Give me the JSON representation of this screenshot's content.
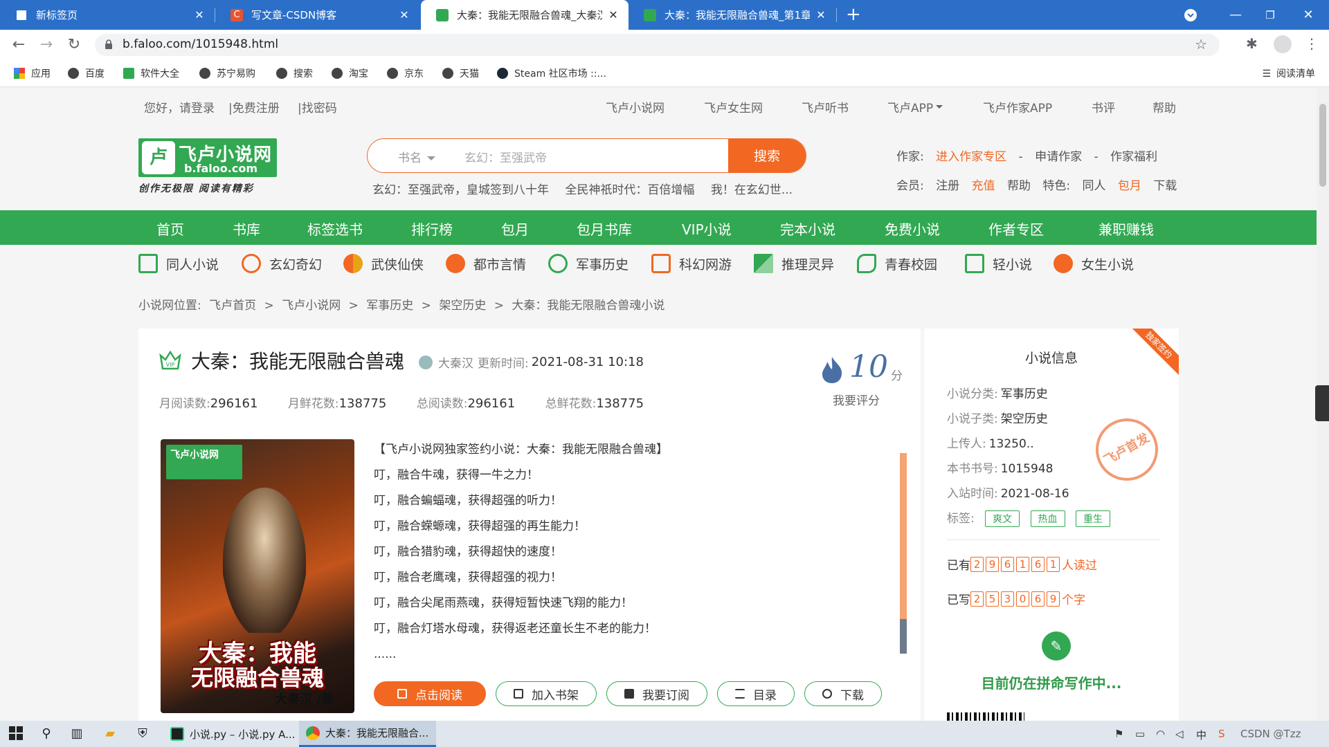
{
  "browser": {
    "tabs": [
      {
        "title": "新标签页",
        "active": false
      },
      {
        "title": "写文章-CSDN博客",
        "active": false
      },
      {
        "title": "大秦：我能无限融合兽魂_大秦汉",
        "active": true
      },
      {
        "title": "大秦：我能无限融合兽魂_第1章",
        "active": false
      }
    ],
    "url": "b.faloo.com/1015948.html",
    "bookmarks": [
      "应用",
      "百度",
      "软件大全",
      "苏宁易购",
      "搜索",
      "淘宝",
      "京东",
      "天猫",
      "Steam 社区市场 ::..."
    ],
    "reading_list": "阅读清单"
  },
  "topbar": {
    "greeting": "您好，请登录",
    "register": "|免费注册",
    "findpwd": "|找密码",
    "links": [
      "飞卢小说网",
      "飞卢女生网",
      "飞卢听书",
      "飞卢APP",
      "飞卢作家APP",
      "书评",
      "帮助"
    ]
  },
  "header": {
    "logo_name": "飞卢小说网",
    "logo_domain": "b.faloo.com",
    "logo_slogan": "创作无极限 阅读有精彩",
    "search_type": "书名",
    "search_placeholder": "玄幻：至强武帝",
    "search_button": "搜索",
    "hot": [
      "玄幻：至强武帝，皇城签到八十年",
      "全民神祇时代：百倍增幅",
      "我！在玄幻世..."
    ],
    "author_label": "作家:",
    "author_links": [
      "进入作家专区",
      "-",
      "申请作家",
      "-",
      "作家福利"
    ],
    "member_label": "会员:",
    "member_links": [
      "注册",
      "充值",
      "帮助",
      "特色:",
      "同人",
      "包月",
      "下载"
    ]
  },
  "mainnav": [
    "首页",
    "书库",
    "标签选书",
    "排行榜",
    "包月",
    "包月书库",
    "VIP小说",
    "完本小说",
    "免费小说",
    "作者专区",
    "兼职赚钱"
  ],
  "categories": [
    {
      "label": "同人小说",
      "color": "#32a852"
    },
    {
      "label": "玄幻奇幻",
      "color": "#f26722"
    },
    {
      "label": "武侠仙侠",
      "color": "#e8a317"
    },
    {
      "label": "都市言情",
      "color": "#f26722"
    },
    {
      "label": "军事历史",
      "color": "#32a852"
    },
    {
      "label": "科幻网游",
      "color": "#f26722"
    },
    {
      "label": "推理灵异",
      "color": "#32a852"
    },
    {
      "label": "青春校园",
      "color": "#32a852"
    },
    {
      "label": "轻小说",
      "color": "#32a852"
    },
    {
      "label": "女生小说",
      "color": "#f26722"
    }
  ],
  "breadcrumb": [
    "小说网位置:",
    "飞卢首页",
    ">",
    "飞卢小说网",
    ">",
    "军事历史",
    ">",
    "架空历史",
    ">",
    "大秦：我能无限融合兽魂小说"
  ],
  "book": {
    "title": "大秦：我能无限融合兽魂",
    "author": "大秦汉",
    "update_label": "更新时间:",
    "update_time": "2021-08-31 10:18",
    "stats": [
      {
        "label": "月阅读数:",
        "value": "296161"
      },
      {
        "label": "月鲜花数:",
        "value": "138775"
      },
      {
        "label": "总阅读数:",
        "value": "296161"
      },
      {
        "label": "总鲜花数:",
        "value": "138775"
      }
    ],
    "score": "10",
    "score_unit": "分",
    "rate_label": "我要评分",
    "cover_logo": "飞卢小说网",
    "cover_line1": "大秦：我能",
    "cover_line2": "无限融合兽魂",
    "cover_author": "大秦汉 /著",
    "intro": [
      "【飞卢小说网独家签约小说：大秦：我能无限融合兽魂】",
      "叮，融合牛魂，获得一牛之力！",
      "叮，融合蝙蝠魂，获得超强的听力！",
      "叮，融合蝾螈魂，获得超强的再生能力！",
      "叮，融合猎豹魂，获得超快的速度！",
      "叮，融合老鹰魂，获得超强的视力！",
      "叮，融合尖尾雨燕魂，获得短暂快速飞翔的能力！",
      "叮，融合灯塔水母魂，获得返老还童长生不老的能力！",
      "......"
    ],
    "actions": [
      "点击阅读",
      "加入书架",
      "我要订阅",
      "目录",
      "下载"
    ]
  },
  "info": {
    "title": "小说信息",
    "ribbon": "独家签约",
    "rows": [
      {
        "label": "小说分类:",
        "value": "军事历史"
      },
      {
        "label": "小说子类:",
        "value": "架空历史"
      },
      {
        "label": "上传人:",
        "value": "13250.."
      },
      {
        "label": "本书书号:",
        "value": "1015948"
      },
      {
        "label": "入站时间:",
        "value": "2021-08-16"
      }
    ],
    "tags_label": "标签:",
    "tags": [
      "爽文",
      "热血",
      "重生"
    ],
    "stamp": "飞卢首发",
    "read_prefix": "已有",
    "read_digits": [
      "2",
      "9",
      "6",
      "1",
      "6",
      "1"
    ],
    "read_suffix": "人读过",
    "write_prefix": "已写",
    "write_digits": [
      "2",
      "5",
      "3",
      "0",
      "6",
      "9"
    ],
    "write_suffix": "个字",
    "status": "目前仍在拼命写作中..."
  },
  "taskbar": {
    "apps": [
      "小说.py – 小说.py A...",
      "大秦：我能无限融合..."
    ],
    "tray_text": "CSDN @Tzz"
  }
}
